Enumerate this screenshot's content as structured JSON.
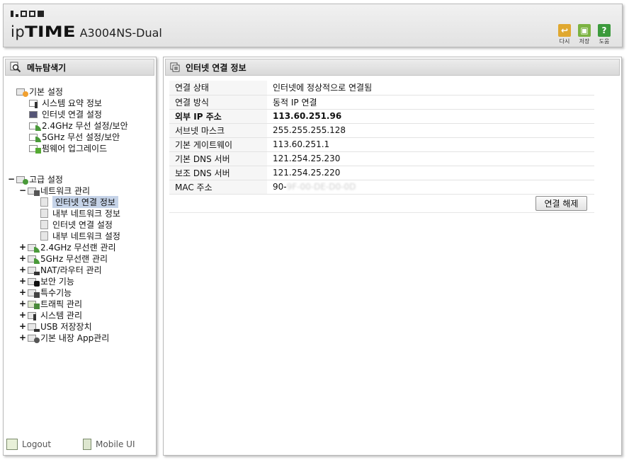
{
  "header": {
    "brand_ip": "ip",
    "brand_time": "TIME",
    "model": "A3004NS-Dual",
    "tools": [
      {
        "label": "다시",
        "icon": "undo-icon",
        "color": "#e0a830",
        "glyph": "↩"
      },
      {
        "label": "저장",
        "icon": "save-icon",
        "color": "#7cb342",
        "glyph": "▣"
      },
      {
        "label": "도움",
        "icon": "help-icon",
        "color": "#3c9a3c",
        "glyph": "?"
      }
    ]
  },
  "sidebar": {
    "title": "메뉴탐색기",
    "basic": {
      "label": "기본 설정",
      "items": [
        "시스템 요약 정보",
        "인터넷 연결 설정",
        "2.4GHz 무선 설정/보안",
        "5GHz 무선 설정/보안",
        "펌웨어 업그레이드"
      ]
    },
    "advanced": {
      "toggle": "−",
      "label": "고급 설정",
      "network": {
        "toggle": "−",
        "label": "네트워크 관리",
        "items": [
          "인터넷 연결 정보",
          "내부 네트워크 정보",
          "인터넷 연결 설정",
          "내부 네트워크 설정"
        ]
      },
      "groups": [
        {
          "label": "2.4GHz 무선랜 관리",
          "toggle": "+"
        },
        {
          "label": "5GHz 무선랜 관리",
          "toggle": "+"
        },
        {
          "label": "NAT/라우터 관리",
          "toggle": "+"
        },
        {
          "label": "보안 기능",
          "toggle": "+"
        },
        {
          "label": "특수기능",
          "toggle": "+"
        },
        {
          "label": "트래픽 관리",
          "toggle": "+"
        },
        {
          "label": "시스템 관리",
          "toggle": "+"
        },
        {
          "label": "USB 저장장치",
          "toggle": "+"
        },
        {
          "label": "기본 내장 App관리",
          "toggle": "+"
        }
      ]
    },
    "footer": {
      "logout": "Logout",
      "mobile": "Mobile UI"
    }
  },
  "main": {
    "title": "인터넷 연결 정보",
    "rows": [
      {
        "key": "연결 상태",
        "value": "인터넷에 정상적으로 연결됨"
      },
      {
        "key": "연결 방식",
        "value": "동적 IP 연결"
      },
      {
        "key": "외부 IP 주소",
        "value": "113.60.251.96"
      },
      {
        "key": "서브넷 마스크",
        "value": "255.255.255.128"
      },
      {
        "key": "기본 게이트웨이",
        "value": "113.60.251.1"
      },
      {
        "key": "기본 DNS 서버",
        "value": "121.254.25.230"
      },
      {
        "key": "보조 DNS 서버",
        "value": "121.254.25.220"
      },
      {
        "key": "MAC 주소",
        "value": "90-",
        "value_obscured": "9F-00-DE-D0-0D"
      }
    ],
    "disconnect_label": "연결 해제"
  }
}
